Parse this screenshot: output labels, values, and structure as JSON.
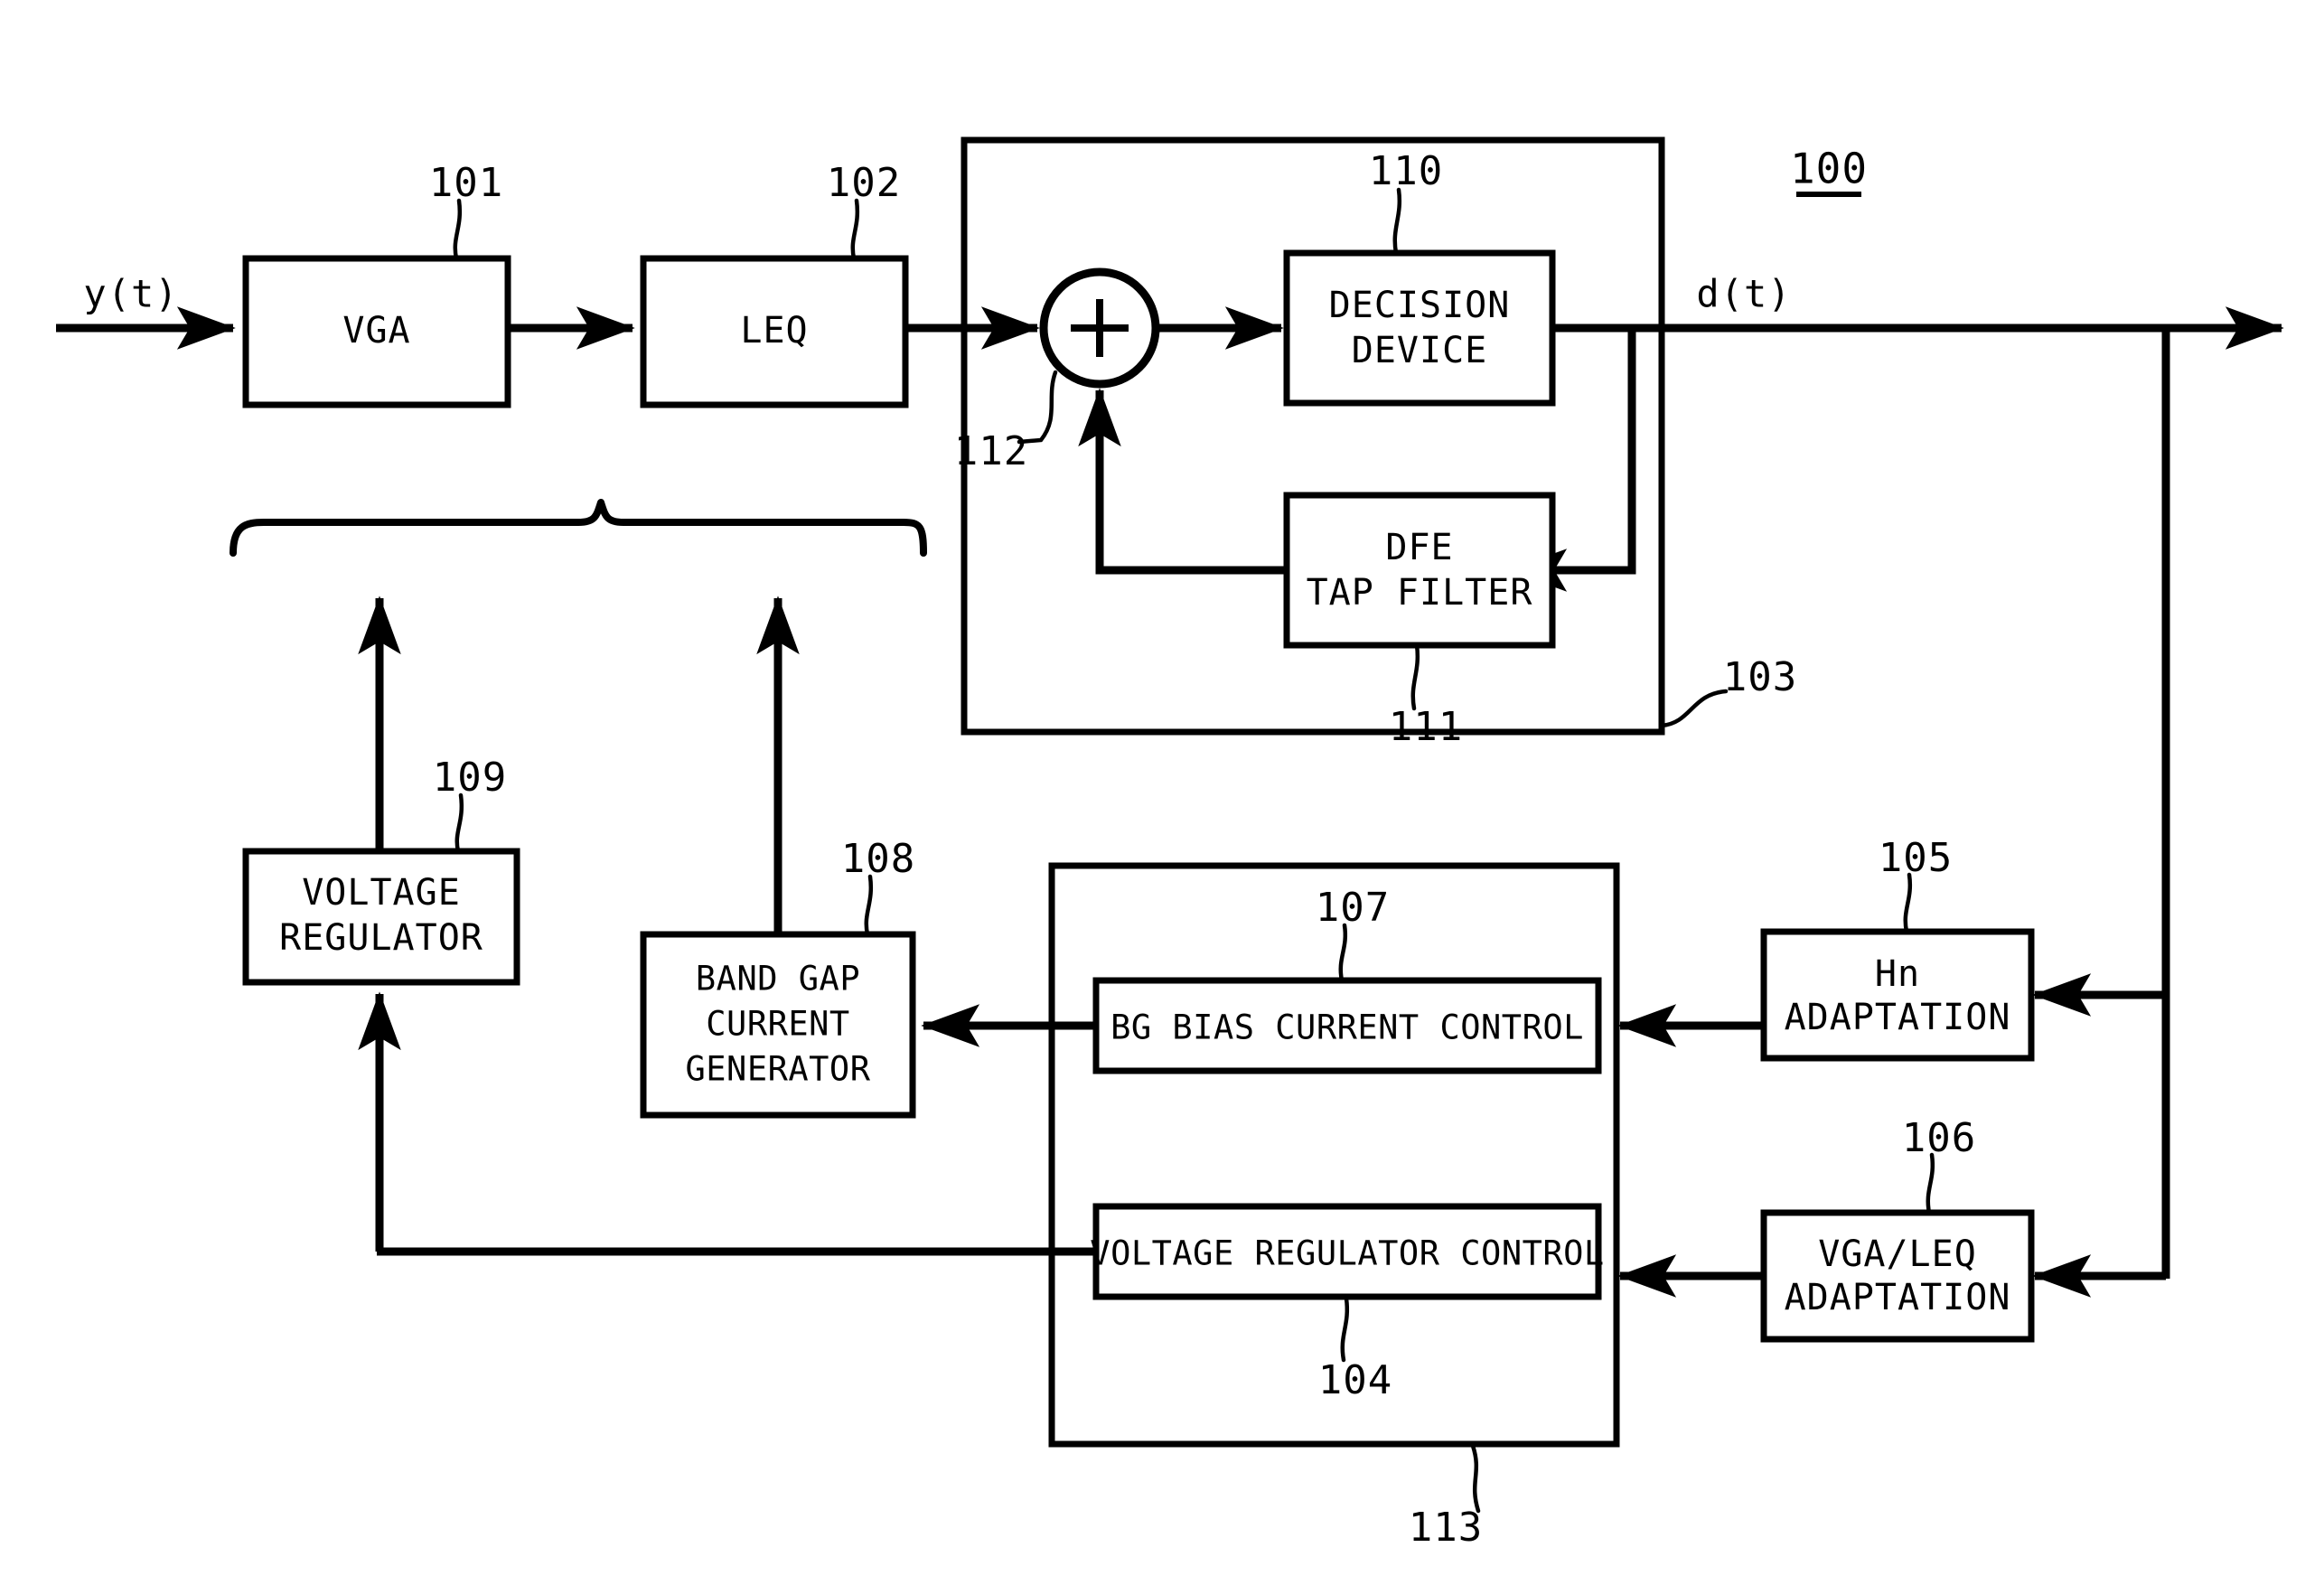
{
  "figure": {
    "id": "100",
    "id_underlined": true
  },
  "signals": {
    "input": "y(t)",
    "output": "d(t)"
  },
  "blocks": [
    {
      "key": "vga",
      "label": "VGA",
      "ref": "101"
    },
    {
      "key": "leq",
      "label": "LEQ",
      "ref": "102"
    },
    {
      "key": "decision",
      "label_line1": "DECISION",
      "label_line2": "DEVICE",
      "ref": "110"
    },
    {
      "key": "dfe",
      "label_line1": "DFE",
      "label_line2": "TAP FILTER",
      "ref": "111"
    },
    {
      "key": "dfe_group",
      "label": "",
      "ref": "103"
    },
    {
      "key": "vreg",
      "label_line1": "VOLTAGE",
      "label_line2": "REGULATOR",
      "ref": "109"
    },
    {
      "key": "bandgap",
      "label_line1": "BAND GAP",
      "label_line2": "CURRENT",
      "label_line3": "GENERATOR",
      "ref": "108"
    },
    {
      "key": "bgbias",
      "label": "BG BIAS CURRENT CONTROL",
      "ref": "107"
    },
    {
      "key": "vregctrl",
      "label": "VOLTAGE REGULATOR CONTROL",
      "ref": "104"
    },
    {
      "key": "ctrlgroup",
      "label": "",
      "ref": "113"
    },
    {
      "key": "hn",
      "label_line1": "Hn",
      "label_line2": "ADAPTATION",
      "ref": "105"
    },
    {
      "key": "vgaleq",
      "label_line1": "VGA/LEQ",
      "label_line2": "ADAPTATION",
      "ref": "106"
    },
    {
      "key": "summer",
      "label": "+",
      "ref": "112"
    }
  ],
  "colors": {
    "line": "#000000",
    "background": "#ffffff"
  }
}
